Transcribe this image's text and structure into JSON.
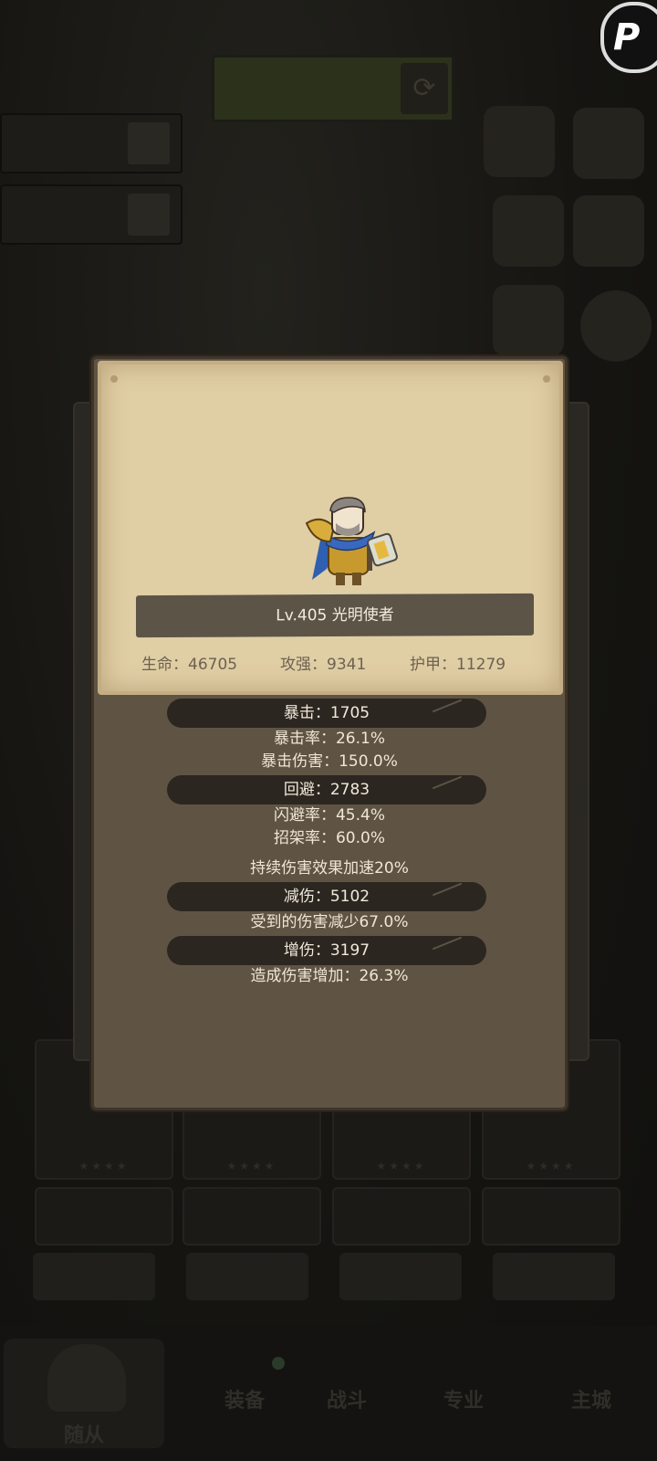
{
  "hero": {
    "name_line": "Lv.405 光明使者",
    "base": [
      {
        "label": "生命：46705"
      },
      {
        "label": "攻强：9341"
      },
      {
        "label": "护甲：11279"
      }
    ]
  },
  "stats": {
    "crit": "暴击：1705",
    "crit_rate": "暴击率：26.1%",
    "crit_damage": "暴击伤害：150.0%",
    "evade": "回避：2783",
    "dodge_rate": "闪避率：45.4%",
    "parry_rate": "招架率：60.0%",
    "dot_speed": "持续伤害效果加速20%",
    "damage_reduction": "减伤：5102",
    "damage_taken_reduced": "受到的伤害减少67.0%",
    "damage_increase": "增伤：3197",
    "damage_dealt_increase": "造成伤害增加：26.3%"
  },
  "background": {
    "bottom_nav": [
      {
        "label": "随从",
        "active": true
      },
      {
        "label": "装备"
      },
      {
        "label": "战斗"
      },
      {
        "label": "专业"
      },
      {
        "label": "主城"
      }
    ]
  },
  "colors": {
    "paper": "#e0cea5",
    "modal_body": "#5f5444",
    "stat_bar": "#2c2620",
    "name_bar": "#5c5447"
  },
  "icons": {
    "hero_portrait": "armored-paladin-hero",
    "refresh": "refresh-arrows-icon",
    "corner_badge": "app-logo-icon"
  }
}
